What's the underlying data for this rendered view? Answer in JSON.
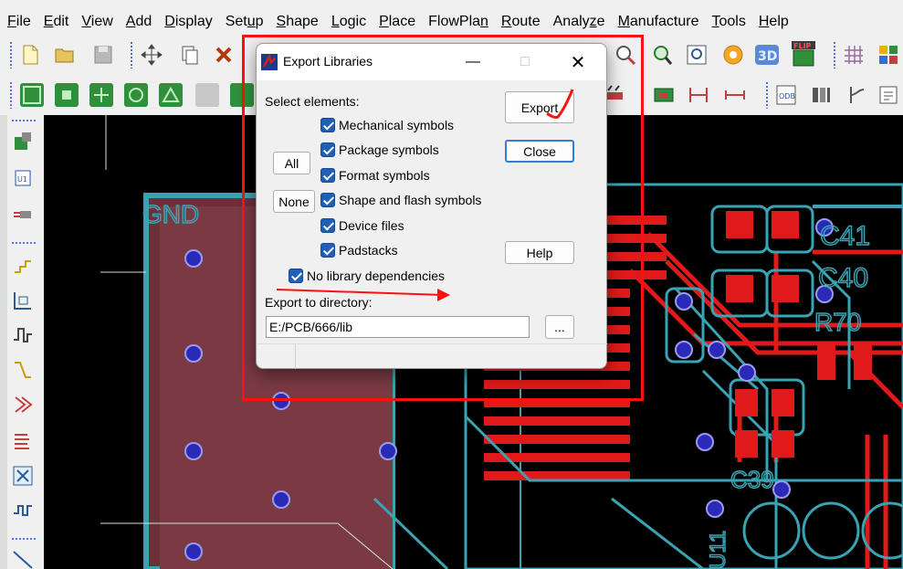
{
  "menu": {
    "items": [
      {
        "u": "F",
        "rest": "ile"
      },
      {
        "u": "E",
        "rest": "dit"
      },
      {
        "u": "V",
        "rest": "iew"
      },
      {
        "u": "A",
        "rest": "dd"
      },
      {
        "u": "D",
        "rest": "isplay"
      },
      {
        "u": "",
        "pre": "Set",
        "uu": "u",
        "rest": "p"
      },
      {
        "u": "S",
        "rest": "hape"
      },
      {
        "u": "L",
        "rest": "ogic"
      },
      {
        "u": "P",
        "rest": "lace"
      },
      {
        "pre": "FlowPla",
        "uu": "n",
        "rest": ""
      },
      {
        "u": "R",
        "rest": "oute"
      },
      {
        "pre": "Analy",
        "uu": "z",
        "rest": "e"
      },
      {
        "u": "M",
        "rest": "anufacture"
      },
      {
        "u": "T",
        "rest": "ools"
      },
      {
        "u": "H",
        "rest": "elp"
      }
    ]
  },
  "dialog": {
    "title": "Export Libraries",
    "select_label": "Select elements:",
    "checkboxes": [
      "Mechanical symbols",
      "Package symbols",
      "Format symbols",
      "Shape and flash symbols",
      "Device files",
      "Padstacks"
    ],
    "no_lib_deps": "No library dependencies",
    "all_button": "All",
    "none_button": "None",
    "export_button": "Export",
    "close_button": "Close",
    "help_button": "Help",
    "dir_label": "Export to directory:",
    "dir_value": "E:/PCB/666/lib",
    "browse_button": "..."
  },
  "canvas_labels": {
    "gnd": "GND",
    "c41": "C41",
    "c40": "C40",
    "r70": "R70",
    "c39": "C39",
    "u11": "U11"
  },
  "colors": {
    "accent": "#1f5fb5",
    "annotation_red": "#ff1010",
    "pcb_teal": "#3aa3b3",
    "pcb_red": "#e01a1a",
    "via_blue": "#2a2ab8"
  }
}
